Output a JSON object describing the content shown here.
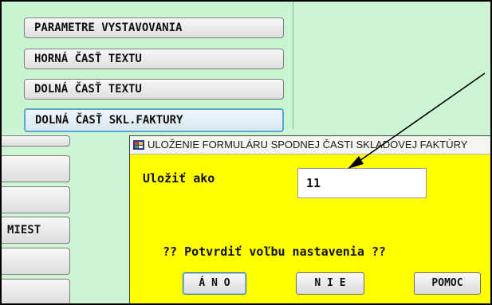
{
  "menu": {
    "items": [
      {
        "label": "PARAMETRE VYSTAVOVANIA"
      },
      {
        "label": "HORNÁ ČASŤ TEXTU"
      },
      {
        "label": "DOLNÁ ČASŤ TEXTU"
      },
      {
        "label": "DOLNÁ ČASŤ SKL.FAKTURY"
      }
    ]
  },
  "side": {
    "miest_label": "MIEST"
  },
  "dialog": {
    "title": "ULOŽENIE FORMULÁRU SPODNEJ ČASTI SKLADOVEJ FAKTÚRY",
    "save_as_label": "Uložiť ako",
    "save_as_value": "11",
    "confirm_text": "?? Potvrdiť voľbu nastavenia ??",
    "buttons": {
      "yes": "Á N O",
      "no": "N I E",
      "help": "POMOC"
    }
  },
  "colors": {
    "background_green": "#c9f4cf",
    "dialog_yellow": "#ffff00",
    "active_border": "#55a8d8"
  },
  "icons": {
    "dialog_title_icon": "app-window-icon"
  }
}
